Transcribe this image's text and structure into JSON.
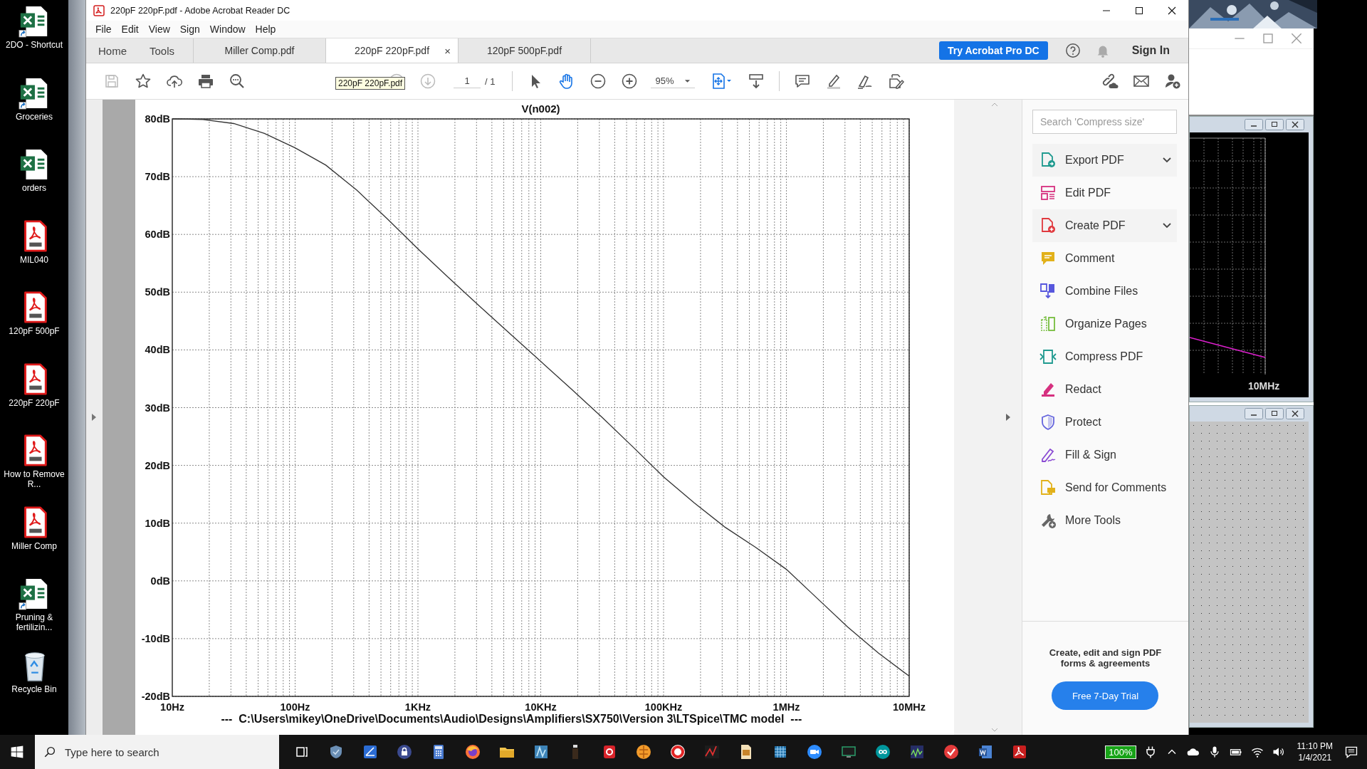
{
  "desktop_icons": [
    {
      "label": "2DO - Shortcut",
      "kind": "excel",
      "shortcut": true
    },
    {
      "label": "Groceries",
      "kind": "excel",
      "shortcut": true
    },
    {
      "label": "orders",
      "kind": "excel",
      "shortcut": false
    },
    {
      "label": "MIL040",
      "kind": "pdf",
      "shortcut": false
    },
    {
      "label": "120pF 500pF",
      "kind": "pdf",
      "shortcut": false
    },
    {
      "label": "220pF 220pF",
      "kind": "pdf",
      "shortcut": false
    },
    {
      "label": "How to Remove R...",
      "kind": "pdf",
      "shortcut": false
    },
    {
      "label": "Miller Comp",
      "kind": "pdf",
      "shortcut": false
    },
    {
      "label": "Pruning & fertilizin...",
      "kind": "excel",
      "shortcut": true
    },
    {
      "label": "Recycle Bin",
      "kind": "recycle",
      "shortcut": false
    }
  ],
  "window": {
    "title": "220pF 220pF.pdf - Adobe Acrobat Reader DC"
  },
  "menu": [
    "File",
    "Edit",
    "View",
    "Sign",
    "Window",
    "Help"
  ],
  "nav_tabs": [
    {
      "label": "Home",
      "selected": false
    },
    {
      "label": "Tools",
      "selected": false
    }
  ],
  "doc_tabs": [
    {
      "label": "Miller Comp.pdf",
      "selected": false
    },
    {
      "label": "220pF 220pF.pdf",
      "selected": true
    },
    {
      "label": "120pF 500pF.pdf",
      "selected": false
    }
  ],
  "close_tab": "×",
  "try_button": "Try Acrobat Pro DC",
  "sign_in": "Sign In",
  "tooltip": "220pF 220pF.pdf",
  "page_field": {
    "value": "1",
    "total": "/ 1"
  },
  "pointer_tools": [
    {
      "kind": "select",
      "selected": false
    },
    {
      "kind": "hand",
      "selected": true
    }
  ],
  "zoom": "95%",
  "document": {
    "chart_data": {
      "type": "line",
      "title": "V(n002)",
      "categories": [
        "10Hz",
        null,
        null,
        null,
        "100Hz",
        null,
        null,
        null,
        "1KHz",
        null,
        null,
        null,
        "10KHz",
        null,
        null,
        null,
        "100KHz",
        null,
        null,
        null,
        "1MHz",
        null,
        null,
        null,
        "10MHz"
      ],
      "series": [
        {
          "color": "#333333",
          "values": [
            80,
            79.9,
            79.2,
            77.5,
            75,
            72,
            67.7,
            62.7,
            57.5,
            52.5,
            47.6,
            42.8,
            38,
            33.2,
            28.3,
            23.2,
            18,
            13.5,
            9.3,
            5.8,
            2,
            -3,
            -8,
            -12.5,
            -16.5
          ]
        }
      ],
      "ylim": [
        -20,
        80
      ],
      "grid": true,
      "yticks": [
        {
          "value": 80,
          "label": "80dB"
        },
        {
          "value": 70,
          "label": "70dB"
        },
        {
          "value": 60,
          "label": "60dB"
        },
        {
          "value": 50,
          "label": "50dB"
        },
        {
          "value": 40,
          "label": "40dB"
        },
        {
          "value": 30,
          "label": "30dB"
        },
        {
          "value": 20,
          "label": "20dB"
        },
        {
          "value": 10,
          "label": "10dB"
        },
        {
          "value": 0,
          "label": "0dB"
        },
        {
          "value": -10,
          "label": "-10dB"
        },
        {
          "value": -20,
          "label": "-20dB"
        }
      ]
    },
    "footer": "---  C:\\Users\\mikey\\OneDrive\\Documents\\Audio\\Designs\\Amplifiers\\SX750\\Version 3\\LTSpice\\TMC model  ---"
  },
  "tools_pane": {
    "search_placeholder": "Search 'Compress size'",
    "items": [
      {
        "label": "Export PDF",
        "kind": "export",
        "expandable": true
      },
      {
        "label": "Edit PDF",
        "kind": "edit",
        "expandable": false
      },
      {
        "label": "Create PDF",
        "kind": "create",
        "expandable": true
      },
      {
        "label": "Comment",
        "kind": "comment",
        "expandable": false
      },
      {
        "label": "Combine Files",
        "kind": "combine",
        "expandable": false
      },
      {
        "label": "Organize Pages",
        "kind": "organize",
        "expandable": false
      },
      {
        "label": "Compress PDF",
        "kind": "compress",
        "expandable": false
      },
      {
        "label": "Redact",
        "kind": "redact",
        "expandable": false
      },
      {
        "label": "Protect",
        "kind": "protect",
        "expandable": false
      },
      {
        "label": "Fill & Sign",
        "kind": "fillsign",
        "expandable": false
      },
      {
        "label": "Send for Comments",
        "kind": "send",
        "expandable": false
      },
      {
        "label": "More Tools",
        "kind": "more",
        "expandable": false
      }
    ],
    "promo": "Create, edit and sign PDF forms & agreements",
    "trial_button": "Free 7-Day Trial"
  },
  "background_window": {
    "axis_label": "10MHz"
  },
  "taskbar": {
    "search_placeholder": "Type here to search",
    "battery": "100%",
    "time": "11:10 PM",
    "date": "1/4/2021"
  }
}
